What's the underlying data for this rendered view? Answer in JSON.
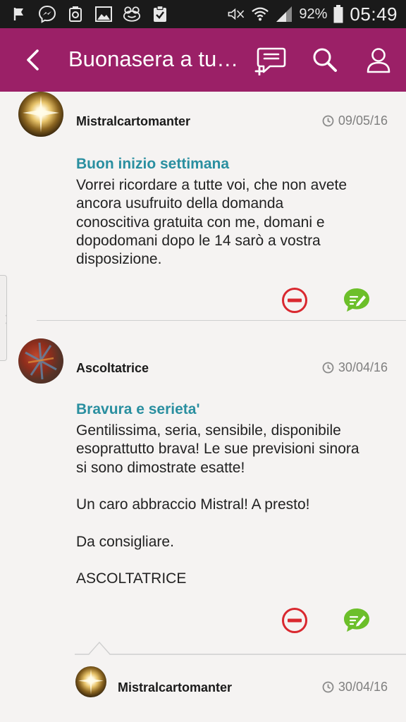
{
  "status_bar": {
    "battery_percent": "92%",
    "time": "05:49",
    "left_icons": [
      "flag-icon",
      "messenger-icon",
      "recycle-icon",
      "image-icon",
      "frog-icon",
      "clipboard-check-icon"
    ],
    "right_icons": [
      "mute-icon",
      "wifi-icon",
      "signal-icon",
      "battery-icon"
    ]
  },
  "app_bar": {
    "title": "Buonasera a tu…",
    "background": "#9b2067",
    "actions": [
      "new-comment-icon",
      "search-icon",
      "profile-icon"
    ]
  },
  "posts": [
    {
      "author": "Mistralcartomanter",
      "date": "09/05/16",
      "title": "Buon inizio settimana",
      "body": "Vorrei ricordare a tutte voi, che non avete\nancora usufruito della domanda\nconoscitiva gratuita con me, domani e\ndopodomani dopo le 14 sarò a vostra\ndisposizione."
    },
    {
      "author": "Ascoltatrice",
      "date": "30/04/16",
      "title": "Bravura e serieta'",
      "body": "Gentilissima, seria, sensibile, disponibile\nesoprattutto brava! Le sue previsioni sinora\nsi sono dimostrate esatte!\n\nUn caro abbraccio Mistral! A presto!\n\nDa consigliare.\n\nASCOLTATRICE"
    }
  ],
  "reply": {
    "author": "Mistralcartomanter",
    "date": "30/04/16"
  },
  "colors": {
    "title_accent": "#2a8fa0",
    "remove_red": "#d9282f",
    "reply_green": "#6cbf2a"
  }
}
